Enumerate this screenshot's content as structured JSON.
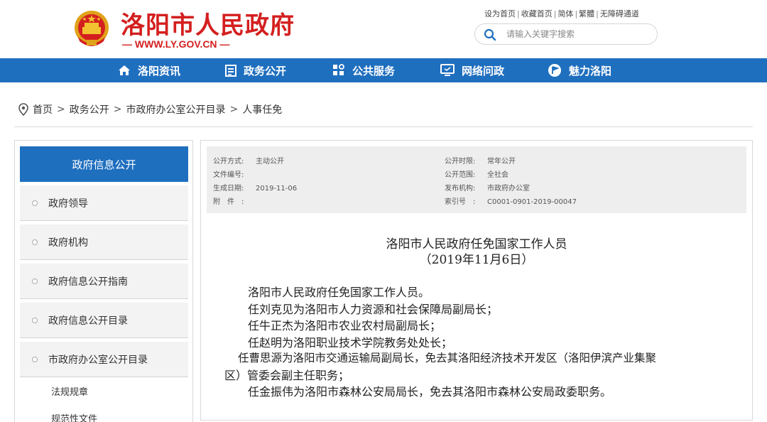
{
  "header": {
    "site_title": "洛阳市人民政府",
    "site_url": "— WWW.LY.GOV.CN —",
    "top_links": [
      "设为首页",
      "收藏首页",
      "简体",
      "繁體",
      "无障碍通道"
    ],
    "search_placeholder": "请输入关键字搜索"
  },
  "nav": {
    "items": [
      {
        "label": "洛阳资讯",
        "icon": "home-icon"
      },
      {
        "label": "政务公开",
        "icon": "document-icon"
      },
      {
        "label": "公共服务",
        "icon": "service-grid-icon"
      },
      {
        "label": "网络问政",
        "icon": "monitor-icon"
      },
      {
        "label": "魅力洛阳",
        "icon": "flag-circle-icon"
      }
    ]
  },
  "breadcrumb": {
    "icon": "location-pin-icon",
    "items": [
      "首页",
      "政务公开",
      "市政府办公室公开目录",
      "人事任免"
    ],
    "separator": ">"
  },
  "sidebar": {
    "title": "政府信息公开",
    "items": [
      "政府领导",
      "政府机构",
      "政府信息公开指南",
      "政府信息公开目录",
      "市政府办公室公开目录"
    ],
    "sub_items": [
      "法规规章",
      "规范性文件"
    ]
  },
  "meta": {
    "open_mode_label": "公开方式:",
    "open_mode": "主动公开",
    "doc_no_label": "文件编号:",
    "doc_no": "",
    "created_label": "生成日期:",
    "created": "2019-11-06",
    "attach_label": "附　件　:",
    "attach": "",
    "period_label": "公开时限:",
    "period": "常年公开",
    "scope_label": "公开范围:",
    "scope": "全社会",
    "publisher_label": "发布机构:",
    "publisher": "市政府办公室",
    "index_label": "索引号　:",
    "index": "C0001-0901-2019-00047"
  },
  "article": {
    "title": "洛阳市人民政府任免国家工作人员",
    "date": "（2019年11月6日）",
    "paragraphs": [
      "洛阳市人民政府任免国家工作人员。",
      "任刘克见为洛阳市人力资源和社会保障局副局长；",
      "任牛正杰为洛阳市农业农村局副局长；",
      "任赵明为洛阳职业技术学院教务处处长；",
      "任曹思源为洛阳市交通运输局副局长，免去其洛阳经济技术开发区（洛阳伊滨产业集聚",
      "区）管委会副主任职务；",
      "任金振伟为洛阳市森林公安局局长，免去其洛阳市森林公安局政委职务。"
    ]
  },
  "colors": {
    "brand_red": "#d41f1f",
    "nav_blue": "#1f6fbf",
    "meta_bg": "#eeeeee"
  }
}
